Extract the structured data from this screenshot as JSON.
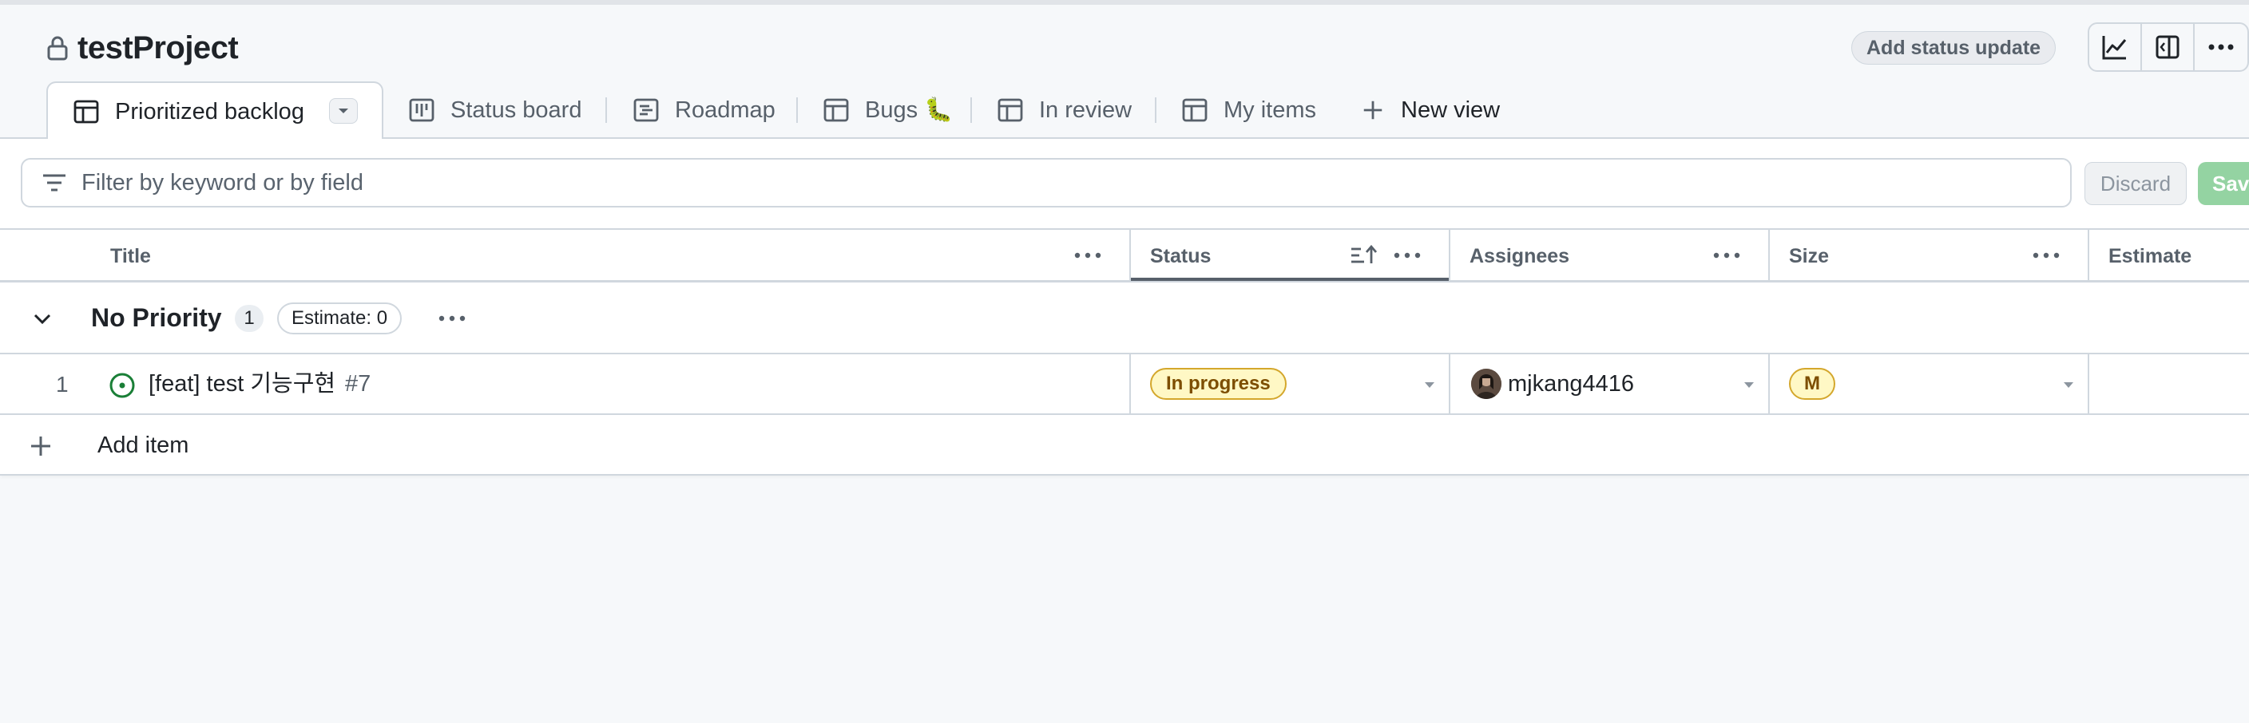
{
  "project": {
    "title": "testProject",
    "add_status_update": "Add status update",
    "header_buttons": [
      {
        "icon": "line-graph-icon"
      },
      {
        "icon": "side-panel-icon"
      },
      {
        "icon": "more-options-icon"
      }
    ]
  },
  "tabs": [
    {
      "label": "Prioritized backlog",
      "icon": "table-icon",
      "active": true
    },
    {
      "label": "Status board",
      "icon": "board-icon"
    },
    {
      "label": "Roadmap",
      "icon": "roadmap-icon"
    },
    {
      "label": "Bugs 🐛",
      "icon": "table-icon"
    },
    {
      "label": "In review",
      "icon": "table-icon"
    },
    {
      "label": "My items",
      "icon": "table-icon"
    },
    {
      "label": "New view",
      "icon": "plus-icon"
    }
  ],
  "filter": {
    "placeholder": "Filter by keyword or by field",
    "value": "",
    "discard_label": "Discard",
    "save_label": "Save"
  },
  "table": {
    "columns": [
      "Title",
      "Status",
      "Assignees",
      "Size",
      "Estimate"
    ],
    "group": {
      "title": "No Priority",
      "count": "1",
      "estimate": "Estimate: 0"
    },
    "rows": [
      {
        "number": "1",
        "title": "[feat] test 기능구현",
        "issue_number": "#7",
        "status": "In progress",
        "assignee": "mjkang4416",
        "size": "M",
        "estimate": ""
      }
    ],
    "add_item_label": "Add item"
  },
  "colors": {
    "background": "#f6f8fa",
    "border": "#d0d7de",
    "status_yellow_bg": "#fff8c5",
    "status_yellow_border": "#d4a72c",
    "open_issue_green": "#1a7f37",
    "save_green": "#94d3a2"
  }
}
